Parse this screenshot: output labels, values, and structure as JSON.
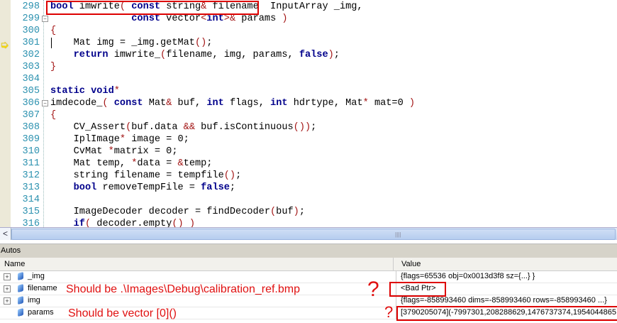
{
  "editor": {
    "current_line": "301",
    "lines": [
      {
        "n": "298",
        "t": [
          [
            "bool",
            "kw"
          ],
          " imwrite",
          [
            "(",
            "pu"
          ],
          " ",
          [
            "const",
            "kw"
          ],
          " string",
          [
            "&",
            "pu"
          ],
          " filename  InputArray _img,"
        ]
      },
      {
        "n": "299",
        "t": [
          "              ",
          [
            "const",
            "kw"
          ],
          " vector",
          [
            "<",
            "pu"
          ],
          [
            "int",
            "kw"
          ],
          [
            ">",
            "pu"
          ],
          [
            "&",
            "pu"
          ],
          " params ",
          [
            ")",
            "pu"
          ]
        ]
      },
      {
        "n": "300",
        "t": [
          [
            "{",
            "pu"
          ]
        ]
      },
      {
        "n": "301",
        "t": [
          "    Mat img = _img.getMat",
          [
            "()",
            "pu"
          ],
          ";"
        ]
      },
      {
        "n": "302",
        "t": [
          "    ",
          [
            "return",
            "kw"
          ],
          " imwrite_",
          [
            "(",
            "pu"
          ],
          "filename, img, params, ",
          [
            "false",
            "kw"
          ],
          [
            ")",
            "pu"
          ],
          ";"
        ]
      },
      {
        "n": "303",
        "t": [
          [
            "}",
            "pu"
          ]
        ]
      },
      {
        "n": "304",
        "t": [
          ""
        ]
      },
      {
        "n": "305",
        "t": [
          [
            "static",
            "kw"
          ],
          " ",
          [
            "void",
            "kw"
          ],
          [
            "*",
            "pu"
          ]
        ]
      },
      {
        "n": "306",
        "t": [
          "imdecode_",
          [
            "(",
            "pu"
          ],
          " ",
          [
            "const",
            "kw"
          ],
          " Mat",
          [
            "&",
            "pu"
          ],
          " buf, ",
          [
            "int",
            "kw"
          ],
          " flags, ",
          [
            "int",
            "kw"
          ],
          " hdrtype, Mat",
          [
            "*",
            "pu"
          ],
          " mat=0 ",
          [
            ")",
            "pu"
          ]
        ]
      },
      {
        "n": "307",
        "t": [
          [
            "{",
            "pu"
          ]
        ]
      },
      {
        "n": "308",
        "t": [
          "    CV_Assert",
          [
            "(",
            "pu"
          ],
          "buf.data ",
          [
            "&&",
            "pu"
          ],
          " buf.isContinuous",
          [
            "()",
            "pu"
          ],
          [
            ")",
            "pu"
          ],
          ";"
        ]
      },
      {
        "n": "309",
        "t": [
          "    IplImage",
          [
            "*",
            "pu"
          ],
          " image = 0;"
        ]
      },
      {
        "n": "310",
        "t": [
          "    CvMat ",
          [
            "*",
            "pu"
          ],
          "matrix = 0;"
        ]
      },
      {
        "n": "311",
        "t": [
          "    Mat temp, ",
          [
            "*",
            "pu"
          ],
          "data = ",
          [
            "&",
            "pu"
          ],
          "temp;"
        ]
      },
      {
        "n": "312",
        "t": [
          "    string filename = tempfile",
          [
            "()",
            "pu"
          ],
          ";"
        ]
      },
      {
        "n": "313",
        "t": [
          "    ",
          [
            "bool",
            "kw"
          ],
          " removeTempFile = ",
          [
            "false",
            "kw"
          ],
          ";"
        ]
      },
      {
        "n": "314",
        "t": [
          ""
        ]
      },
      {
        "n": "315",
        "t": [
          "    ImageDecoder decoder = findDecoder",
          [
            "(",
            "pu"
          ],
          "buf",
          [
            ")",
            "pu"
          ],
          ";"
        ]
      },
      {
        "n": "316",
        "t": [
          "    ",
          [
            "if",
            "kw"
          ],
          [
            "(",
            "pu"
          ],
          " decoder.empty",
          [
            "()",
            "pu"
          ],
          " ",
          [
            ")",
            "pu"
          ]
        ]
      }
    ]
  },
  "autos": {
    "title": "Autos",
    "col_name": "Name",
    "col_value": "Value",
    "rows": [
      {
        "name": "_img",
        "value": "{flags=65536 obj=0x0013d3f8 sz={...} }",
        "expandable": true
      },
      {
        "name": "filename",
        "value": "<Bad Ptr>",
        "expandable": true
      },
      {
        "name": "img",
        "value": "{flags=-858993460 dims=-858993460 rows=-858993460 ...}",
        "expandable": true
      },
      {
        "name": "params",
        "value": "[3790205074](-7997301,208288629,1476737374,1954044865,",
        "expandable": false
      }
    ]
  },
  "annotations": {
    "filename_note": "Should be .\\Images\\Debug\\calibration_ref.bmp",
    "params_note": "Should be vector [0]()",
    "question1": "?",
    "question2": "?"
  },
  "colors": {
    "annotation": "#e01010",
    "keyword": "#00008b"
  }
}
